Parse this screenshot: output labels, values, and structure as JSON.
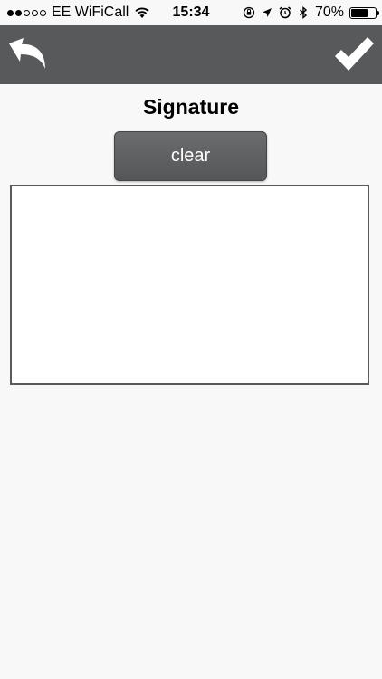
{
  "status_bar": {
    "signal_strength": 2,
    "signal_total": 5,
    "carrier": "EE WiFiCall",
    "time": "15:34",
    "battery_percent": "70%",
    "battery_level": 0.7,
    "icons": [
      "wifi-icon",
      "orientation-lock-icon",
      "location-arrow-icon",
      "alarm-clock-icon",
      "bluetooth-icon",
      "battery-icon"
    ]
  },
  "toolbar": {
    "background": "#58595b",
    "undo_icon": "undo-arrow-icon",
    "confirm_icon": "checkmark-icon"
  },
  "page": {
    "title": "Signature",
    "clear_label": "clear"
  }
}
